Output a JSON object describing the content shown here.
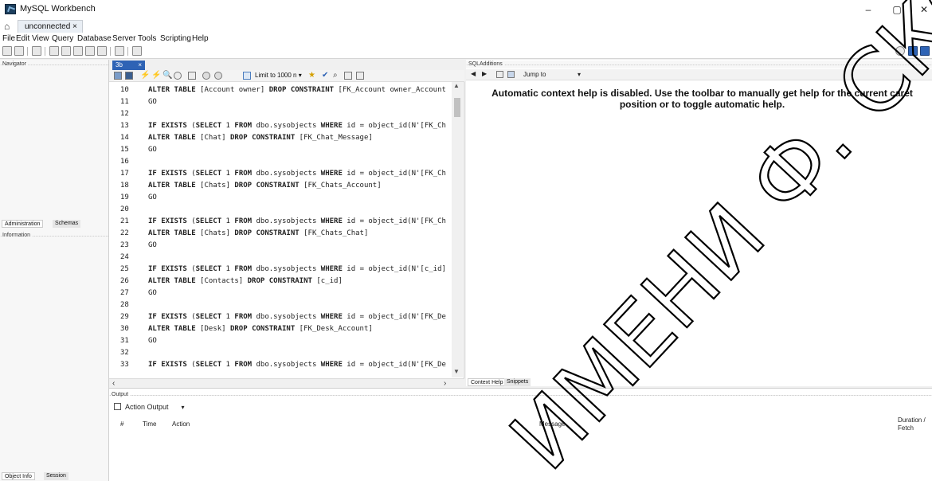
{
  "window": {
    "title": "MySQL Workbench",
    "minimize": "–",
    "maximize": "▢",
    "close": "✕"
  },
  "tabs": {
    "connection_tab": "unconnected  ×"
  },
  "menu": {
    "items": [
      "File",
      "Edit",
      "View",
      "Query",
      "Database",
      "Server",
      "Tools",
      "Scripting",
      "Help"
    ]
  },
  "navigator": {
    "header": "Navigator",
    "tabs": [
      "Administration",
      "Schemas"
    ],
    "info_header": "Information",
    "bottom_tabs": [
      "Object Info",
      "Session"
    ]
  },
  "editor": {
    "tab_label": "3b",
    "tab_close": "×",
    "limit_label": "Limit to 1000 n",
    "lines": [
      {
        "n": "10",
        "text": "ALTER TABLE [Account owner] DROP CONSTRAINT [FK_Account owner_Account"
      },
      {
        "n": "11",
        "text": "GO"
      },
      {
        "n": "12",
        "text": ""
      },
      {
        "n": "13",
        "text": "IF EXISTS (SELECT 1 FROM dbo.sysobjects WHERE id = object_id(N'[FK_Ch"
      },
      {
        "n": "14",
        "text": "ALTER TABLE [Chat] DROP CONSTRAINT [FK_Chat_Message]"
      },
      {
        "n": "15",
        "text": "GO"
      },
      {
        "n": "16",
        "text": ""
      },
      {
        "n": "17",
        "text": "IF EXISTS (SELECT 1 FROM dbo.sysobjects WHERE id = object_id(N'[FK_Ch"
      },
      {
        "n": "18",
        "text": "ALTER TABLE [Chats] DROP CONSTRAINT [FK_Chats_Account]"
      },
      {
        "n": "19",
        "text": "GO"
      },
      {
        "n": "20",
        "text": ""
      },
      {
        "n": "21",
        "text": "IF EXISTS (SELECT 1 FROM dbo.sysobjects WHERE id = object_id(N'[FK_Ch"
      },
      {
        "n": "22",
        "text": "ALTER TABLE [Chats] DROP CONSTRAINT [FK_Chats_Chat]"
      },
      {
        "n": "23",
        "text": "GO"
      },
      {
        "n": "24",
        "text": ""
      },
      {
        "n": "25",
        "text": "IF EXISTS (SELECT 1 FROM dbo.sysobjects WHERE id = object_id(N'[c_id]"
      },
      {
        "n": "26",
        "text": "ALTER TABLE [Contacts] DROP CONSTRAINT [c_id]"
      },
      {
        "n": "27",
        "text": "GO"
      },
      {
        "n": "28",
        "text": ""
      },
      {
        "n": "29",
        "text": "IF EXISTS (SELECT 1 FROM dbo.sysobjects WHERE id = object_id(N'[FK_De"
      },
      {
        "n": "30",
        "text": "ALTER TABLE [Desk] DROP CONSTRAINT [FK_Desk_Account]"
      },
      {
        "n": "31",
        "text": "GO"
      },
      {
        "n": "32",
        "text": ""
      },
      {
        "n": "33",
        "text": "IF EXISTS (SELECT 1 FROM dbo.sysobjects WHERE id = object_id(N'[FK_De"
      }
    ]
  },
  "sql_additions": {
    "header": "SQLAdditions",
    "jump_to": "Jump to",
    "help_text": "Automatic context help is disabled. Use the toolbar to manually get help for the current caret position or to toggle automatic help.",
    "bottom_tabs": [
      "Context Help",
      "Snippets"
    ]
  },
  "output": {
    "header": "Output",
    "selector": "Action Output",
    "columns": [
      "#",
      "Time",
      "Action",
      "Message",
      "Duration / Fetch"
    ]
  },
  "watermark": {
    "text": "ИМЕНИ Ф. СКОРИ"
  }
}
